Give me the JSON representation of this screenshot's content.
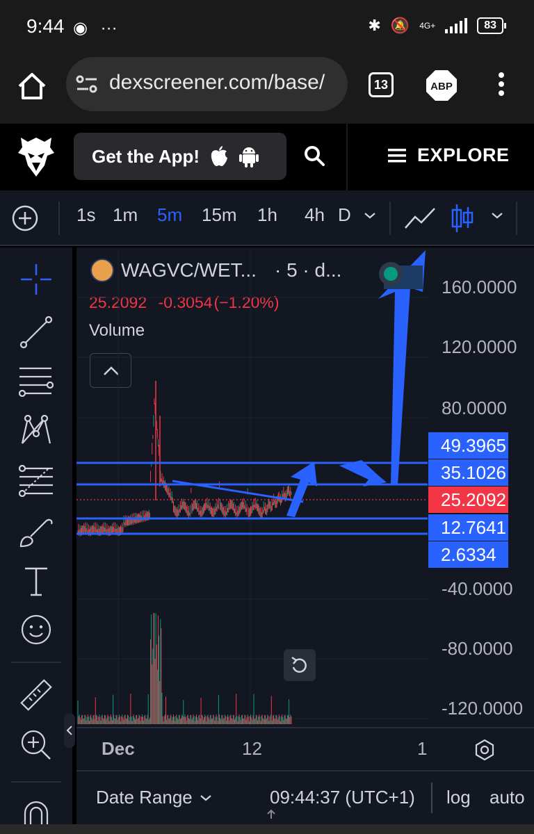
{
  "status_bar": {
    "time": "9:44",
    "network": "4G+",
    "battery": "83"
  },
  "browser": {
    "url": "dexscreener.com/base/",
    "tab_count": "13",
    "adblock_label": "ABP"
  },
  "site_header": {
    "get_app_label": "Get the App!",
    "explore_label": "EXPLORE"
  },
  "chart_toolbar": {
    "intervals": [
      "1s",
      "1m",
      "5m",
      "15m",
      "1h",
      "4h",
      "D"
    ],
    "active_interval": "5m"
  },
  "chart": {
    "pair": "WAGVC/WET...",
    "interval_suffix": "· 5 · d...",
    "last_price": "25.2092",
    "change": "-0.3054",
    "change_pct": "(−1.20%)",
    "volume_label": "Volume",
    "up_color": "#089981",
    "down_color": "#f23645",
    "drawing_color": "#2962ff"
  },
  "chart_data": {
    "type": "line",
    "x_ticks": [
      "Dec",
      "12",
      "1"
    ],
    "y_ticks": [
      "160.0000",
      "120.0000",
      "80.0000",
      "-40.0000",
      "-80.0000",
      "-120.0000"
    ],
    "ylim": [
      -120,
      160
    ],
    "price_tags": [
      {
        "value": "49.3965",
        "kind": "line"
      },
      {
        "value": "35.1026",
        "kind": "line"
      },
      {
        "value": "25.2092",
        "kind": "last"
      },
      {
        "value": "12.7641",
        "kind": "line"
      },
      {
        "value": "2.6334",
        "kind": "line"
      }
    ]
  },
  "bottom_bar": {
    "date_range": "Date Range",
    "clock": "09:44:37 (UTC+1)",
    "log": "log",
    "auto": "auto"
  }
}
